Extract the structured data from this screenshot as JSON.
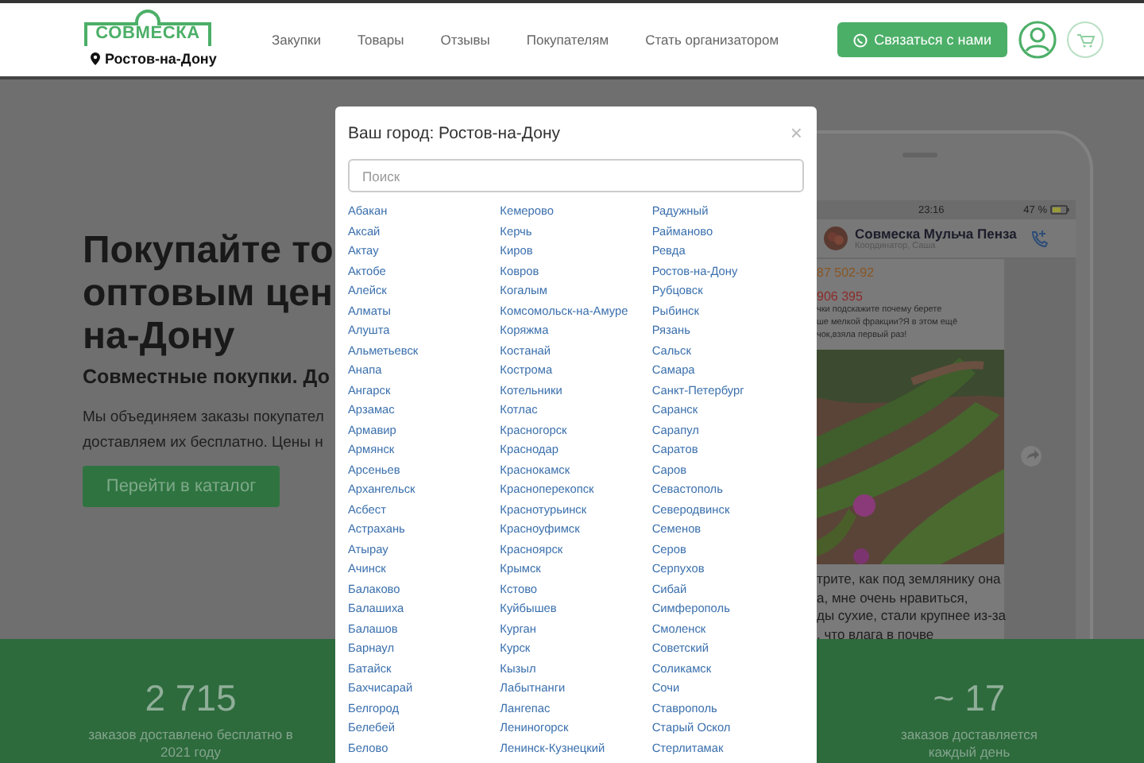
{
  "header": {
    "logo": "СОВМЕСКА",
    "city": "Ростов-на-Дону",
    "nav": [
      "Закупки",
      "Товары",
      "Отзывы",
      "Покупателям",
      "Стать организатором"
    ],
    "contact_button": "Связаться с нами"
  },
  "hero": {
    "title_lines": [
      "Покупайте то",
      "оптовым цен",
      "на-Дону"
    ],
    "subtitle": "Совместные покупки. До",
    "paragraph_lines": [
      "Мы объединяем заказы покупател",
      "доставляем их бесплатно. Цены н"
    ],
    "catalog_button": "Перейти в каталог"
  },
  "phone": {
    "time": "23:16",
    "battery": "47 %",
    "chat_title": "Совмеска Мульча Пенза",
    "chat_subtitle": "Координатор, Саша",
    "sender_1": "87 502-92",
    "sender_2": "906 395",
    "question_lines": [
      "чки подскажите почему берете",
      "ше мелкой фракции?Я в этом ещё",
      "чок,взяла первый раз!"
    ],
    "photo": {
      "kind": "picture"
    },
    "answer_lines": [
      "трите, как под землянику она",
      "а, мне очень нравиться,",
      "ды сухие, стали крупнее из-за",
      ", что влага в почве"
    ]
  },
  "stats": [
    {
      "number": "2 715",
      "label": "заказов доставлено бесплатно в 2021 году"
    },
    {
      "number": "~ 17",
      "label": "заказов доставляется каждый день"
    }
  ],
  "city_modal": {
    "title": "Ваш город: Ростов-на-Дону",
    "close": "×",
    "search": {
      "placeholder": "Поиск"
    },
    "columns": [
      [
        "Абакан",
        "Аксай",
        "Актау",
        "Актобе",
        "Алейск",
        "Алматы",
        "Алушта",
        "Альметьевск",
        "Анапа",
        "Ангарск",
        "Арзамас",
        "Армавир",
        "Армянск",
        "Арсеньев",
        "Архангельск",
        "Асбест",
        "Астрахань",
        "Атырау",
        "Ачинск",
        "Балаково",
        "Балашиха",
        "Балашов",
        "Барнаул",
        "Батайск",
        "Бахчисарай",
        "Белгород",
        "Белебей",
        "Белово"
      ],
      [
        "Кемерово",
        "Керчь",
        "Киров",
        "Ковров",
        "Когалым",
        "Комсомольск-на-Амуре",
        "Коряжма",
        "Костанай",
        "Кострома",
        "Котельники",
        "Котлас",
        "Красногорск",
        "Краснодар",
        "Краснокамск",
        "Красноперекопск",
        "Краснотурьинск",
        "Красноуфимск",
        "Красноярск",
        "Крымск",
        "Кстово",
        "Куйбышев",
        "Курган",
        "Курск",
        "Кызыл",
        "Лабытнанги",
        "Лангепас",
        "Лениногорск",
        "Ленинск-Кузнецкий"
      ],
      [
        "Радужный",
        "Райманово",
        "Ревда",
        "Ростов-на-Дону",
        "Рубцовск",
        "Рыбинск",
        "Рязань",
        "Сальск",
        "Самара",
        "Санкт-Петербург",
        "Саранск",
        "Сарапул",
        "Саратов",
        "Саров",
        "Севастополь",
        "Северодвинск",
        "Семенов",
        "Серов",
        "Серпухов",
        "Сибай",
        "Симферополь",
        "Смоленск",
        "Советский",
        "Соликамск",
        "Сочи",
        "Ставрополь",
        "Старый Оскол",
        "Стерлитамак"
      ]
    ]
  }
}
